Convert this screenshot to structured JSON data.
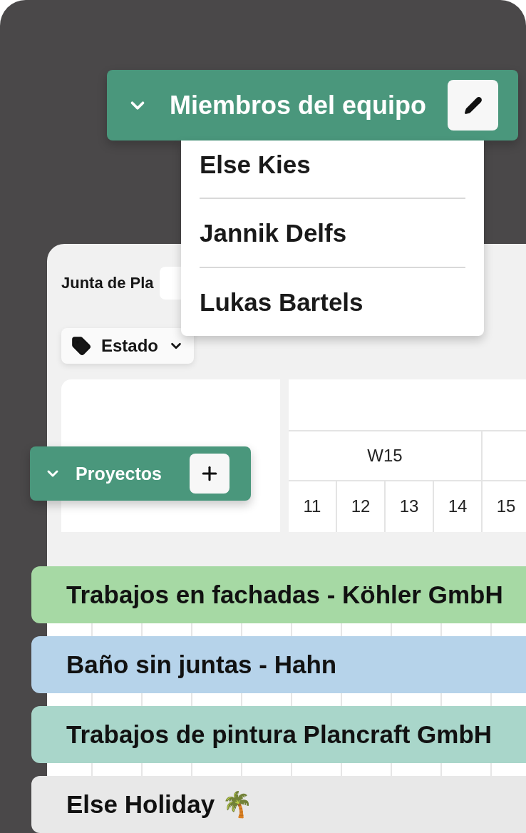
{
  "team_menu": {
    "title": "Miembros del equipo",
    "expanded": true,
    "members": [
      {
        "name": "Else Kies"
      },
      {
        "name": "Jannik Delfs"
      },
      {
        "name": "Lukas Bartels"
      }
    ]
  },
  "board": {
    "title": "Junta de Pla",
    "filter": {
      "label": "Estado"
    },
    "timeline": {
      "weeks": [
        {
          "label": "W15",
          "days": [
            "11",
            "12",
            "13",
            "14"
          ]
        },
        {
          "days": [
            "15"
          ]
        }
      ]
    }
  },
  "projects_panel": {
    "title": "Proyectos",
    "expanded": true
  },
  "bars": [
    {
      "label": "Trabajos en fachadas - Köhler GmbH",
      "color": "#a6d9a4"
    },
    {
      "label": "Baño sin juntas - Hahn",
      "color": "#b6d3ea"
    },
    {
      "label": "Trabajos de pintura Plancraft GmbH",
      "color": "#a9d6ca"
    },
    {
      "label": "Else Holiday 🌴",
      "color": "#e8e8e8"
    }
  ]
}
